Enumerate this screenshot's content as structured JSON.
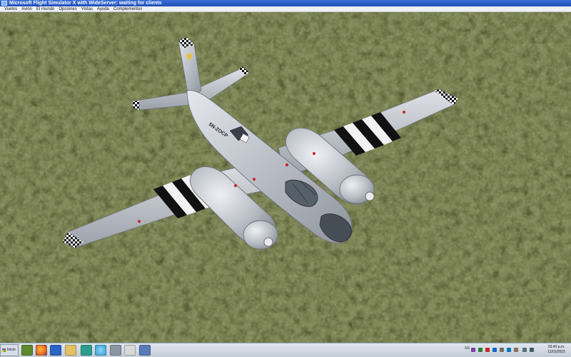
{
  "window": {
    "title": "Microsoft Flight Simulator X with WideServer: waiting for clients"
  },
  "menu": {
    "items": [
      "Vuelos",
      "Avión",
      "El mundo",
      "Opciones",
      "Vistas",
      "Ayuda",
      "Complementos"
    ]
  },
  "scene": {
    "description_icon": "airplane-in-flight",
    "aircraft_tail_code": "5N-ZOCP",
    "colors": {
      "ground": "#4d5229",
      "fuselage": "#c8ccd3",
      "stripe_dark": "#111111",
      "stripe_light": "#f2f2f2",
      "accent_red": "#cc2222"
    }
  },
  "taskbar": {
    "start_label": "Inicio",
    "apps": [
      {
        "name": "start-orb-app",
        "icon": "generic-app-icon",
        "color": "#5c8a2c"
      },
      {
        "name": "firefox-app",
        "icon": "firefox-icon",
        "color": "#e8731c"
      },
      {
        "name": "fsx-app",
        "icon": "flight-sim-icon",
        "color": "#2a64c5"
      },
      {
        "name": "folder-app",
        "icon": "folder-icon",
        "color": "#e3c065"
      },
      {
        "name": "fsuipc-app",
        "icon": "fsuipc-icon",
        "color": "#2d9d8e"
      },
      {
        "name": "internet-app",
        "icon": "globe-icon",
        "color": "#35a2d8"
      },
      {
        "name": "tool-app",
        "icon": "tool-icon",
        "color": "#8b96a5"
      },
      {
        "name": "opus-app",
        "icon": "opus-icon",
        "color": "#d8d8d8"
      },
      {
        "name": "other-app",
        "icon": "misc-icon",
        "color": "#5a7ab8"
      }
    ],
    "tray": {
      "language": "ES",
      "time": "03:40 p.m.",
      "date": "11/01/2015"
    }
  }
}
